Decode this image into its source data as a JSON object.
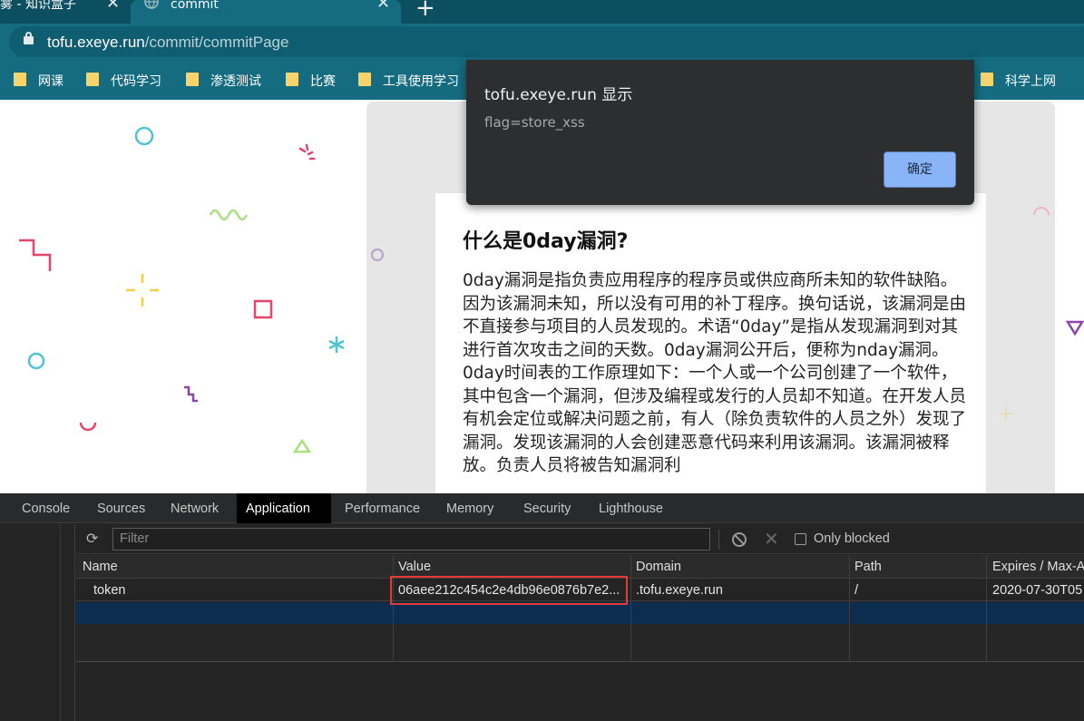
{
  "browser": {
    "tabs": [
      {
        "title": "迷雾 - 知识盒子",
        "close": "✕"
      },
      {
        "title": "commit",
        "close": "✕"
      }
    ],
    "new_tab": "+",
    "address": {
      "host": "tofu.exeye.run",
      "path": "/commit/commitPage"
    },
    "bookmarks": [
      "网课",
      "代码学习",
      "渗透测试",
      "比赛",
      "工具使用学习",
      "科学上网"
    ]
  },
  "alert": {
    "title": "tofu.exeye.run 显示",
    "message": "flag=store_xss",
    "ok_label": "确定"
  },
  "article": {
    "title": "什么是0day漏洞?",
    "body": "0day漏洞是指负责应用程序的程序员或供应商所未知的软件缺陷。因为该漏洞未知，所以没有可用的补丁程序。换句话说，该漏洞是由不直接参与项目的人员发现的。术语“0day”是指从发现漏洞到对其进行首次攻击之间的天数。0day漏洞公开后，便称为nday漏洞。0day时间表的工作原理如下：一个人或一个公司创建了一个软件，其中包含一个漏洞，但涉及编程或发行的人员却不知道。在开发人员有机会定位或解决问题之前，有人（除负责软件的人员之外）发现了漏洞。发现该漏洞的人会创建恶意代码来利用该漏洞。该漏洞被释放。负责人员将被告知漏洞利"
  },
  "devtools": {
    "tabs": [
      "Console",
      "Sources",
      "Network",
      "Application",
      "Performance",
      "Memory",
      "Security",
      "Lighthouse"
    ],
    "active_tab": "Application",
    "filter_placeholder": "Filter",
    "only_blocked_label": "Only blocked",
    "table": {
      "columns": [
        "Name",
        "Value",
        "Domain",
        "Path",
        "Expires / Max-A"
      ],
      "rows": [
        {
          "name": "token",
          "value": "06aee212c454c2e4db96e0876b7e2...",
          "domain": ".tofu.exeye.run",
          "path": "/",
          "expires": "2020-07-30T05"
        }
      ]
    }
  },
  "colors": {
    "tab_bar": "#0b4f61",
    "toolbar": "#156b80",
    "alert_bg": "#2d2e30",
    "alert_button": "#8ab4f8",
    "devtools_bg": "#242424",
    "highlight_border": "#e53935"
  }
}
